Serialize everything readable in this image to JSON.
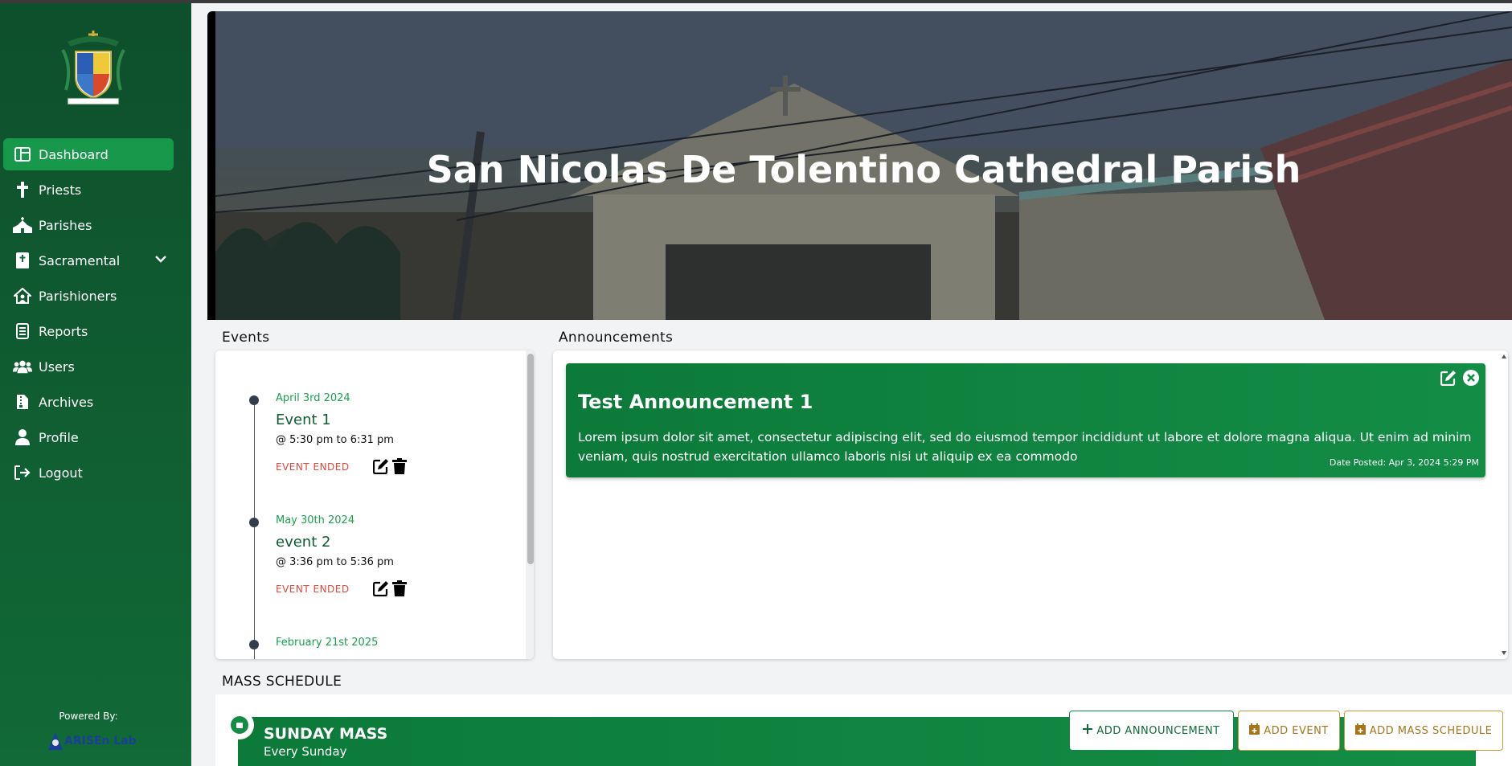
{
  "sidebar": {
    "items": [
      {
        "label": "Dashboard",
        "icon": "dashboard-icon",
        "active": true
      },
      {
        "label": "Priests",
        "icon": "cross-icon"
      },
      {
        "label": "Parishes",
        "icon": "church-icon"
      },
      {
        "label": "Sacramental",
        "icon": "bible-icon"
      },
      {
        "label": "Parishioners",
        "icon": "house-icon"
      },
      {
        "label": "Reports",
        "icon": "report-icon"
      },
      {
        "label": "Users",
        "icon": "users-icon"
      },
      {
        "label": "Archives",
        "icon": "archive-icon"
      },
      {
        "label": "Profile",
        "icon": "user-icon"
      },
      {
        "label": "Logout",
        "icon": "logout-icon"
      }
    ],
    "powered_by": "Powered By:",
    "lab_name": "ARISEn Lab"
  },
  "banner": {
    "title": "San Nicolas De Tolentino Cathedral Parish"
  },
  "events": {
    "heading": "Events",
    "items": [
      {
        "date": "April 3rd 2024",
        "name": "Event 1",
        "time": "@ 5:30 pm to 6:31 pm",
        "status": "EVENT ENDED"
      },
      {
        "date": "May 30th 2024",
        "name": "event 2",
        "time": "@ 3:36 pm to 5:36 pm",
        "status": "EVENT ENDED"
      },
      {
        "date": "February 21st 2025",
        "name": "",
        "time": "",
        "status": ""
      }
    ]
  },
  "announcements": {
    "heading": "Announcements",
    "items": [
      {
        "title": "Test Announcement 1",
        "body": "Lorem ipsum dolor sit amet, consectetur adipiscing elit, sed do eiusmod tempor incididunt ut labore et dolore magna aliqua. Ut enim ad minim veniam, quis nostrud exercitation ullamco laboris nisi ut aliquip ex ea commodo",
        "date_posted": "Date Posted: Apr 3, 2024 5:29 PM"
      }
    ]
  },
  "mass_schedule": {
    "heading": "MASS SCHEDULE",
    "items": [
      {
        "title": "SUNDAY MASS",
        "subtitle": "Every Sunday"
      }
    ]
  },
  "actions": {
    "add_announcement": "ADD ANNOUNCEMENT",
    "add_event": "ADD EVENT",
    "add_mass_schedule": "ADD MASS SCHEDULE"
  },
  "colors": {
    "sidebar": "#116a37",
    "active": "#18984a",
    "accent": "#138d46",
    "ended": "#e0463a",
    "gold": "#a8741a"
  }
}
